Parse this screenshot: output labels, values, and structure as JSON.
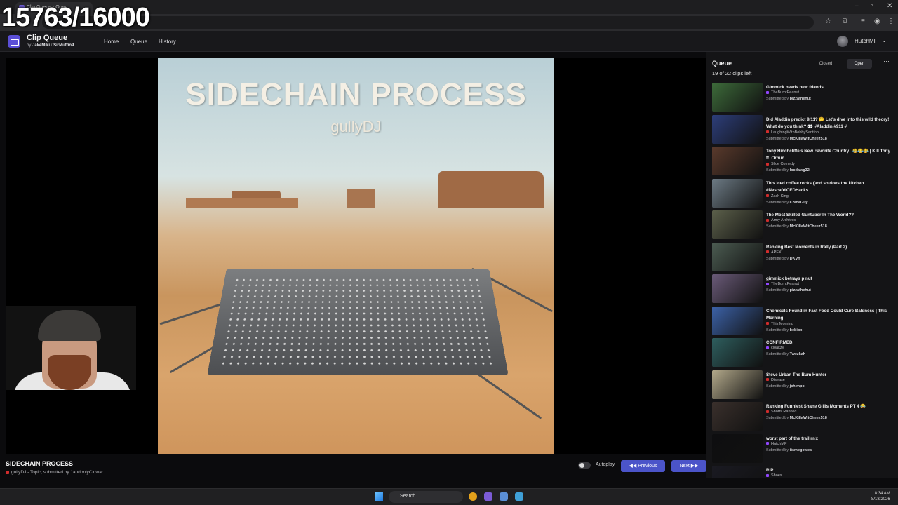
{
  "browser": {
    "tab_title": "Clip Queue - Open",
    "counter_overlay": "15763/16000"
  },
  "app": {
    "title": "Clip Queue",
    "by_text": "by",
    "author1": "JakeMiki",
    "separator": "/",
    "author2": "SirMuffin9",
    "nav": [
      "Home",
      "Queue",
      "History"
    ],
    "active_nav": "Queue",
    "user_name": "HutchMF"
  },
  "player": {
    "art_title": "SIDECHAIN PROCESS",
    "art_subtitle": "gullyDJ"
  },
  "current_clip": {
    "title": "SIDECHAIN PROCESS",
    "meta": "gullyDJ - Topic, submitted by 1andonlyCidwar"
  },
  "controls": {
    "autoplay_label": "Autoplay",
    "autoplay_on": false,
    "previous_label": "Previous",
    "next_label": "Next"
  },
  "queue": {
    "title": "Queue",
    "count_text": "19 of 22 clips left",
    "closed_label": "Closed",
    "open_label": "Open",
    "items": [
      {
        "title": "Gimmick needs new friends",
        "channel": "TheBurntPeanut",
        "submitted_prefix": "Submitted by",
        "submitter": "pizzathehut",
        "platform_color": "#9146ff",
        "thumb": "#3d6b3a"
      },
      {
        "title": "Did Aladdin predict 9/11? 🤔 Let's dive into this wild theory! What do you think? 👀 #Aladdin #911 #",
        "channel": "LaughingWithBobbySantino",
        "submitted_prefix": "Submitted by",
        "submitter": "McKillaWitCheez518",
        "platform_color": "#d12c2c",
        "thumb": "#2d3e7a"
      },
      {
        "title": "Tony Hinchcliffe's New Favorite Country.. 😂😂😂 | Kill Tony ft. Orhun",
        "channel": "Slice Comedy",
        "submitted_prefix": "Submitted by",
        "submitter": "locdawg32",
        "platform_color": "#d12c2c",
        "thumb": "#5a3a2c"
      },
      {
        "title": "This iced coffee rocks (and so does the kitchen #NescaféICEDHacks",
        "channel": "Zach King",
        "submitted_prefix": "Submitted by",
        "submitter": "ChibaGuy",
        "platform_color": "#d12c2c",
        "thumb": "#6c7a84"
      },
      {
        "title": "The Most Skilled Guntuber In The World??",
        "channel": "Army Archives",
        "submitted_prefix": "Submitted by",
        "submitter": "McKillaWitCheez518",
        "platform_color": "#d12c2c",
        "thumb": "#5b5f4a"
      },
      {
        "title": "Ranking Best Moments in Rally (Part 2)",
        "channel": "APEX",
        "submitted_prefix": "Submitted by",
        "submitter": "DKVY_",
        "platform_color": "#d12c2c",
        "thumb": "#4c5c52"
      },
      {
        "title": "gimmick betrays p nut",
        "channel": "TheBurntPeanut",
        "submitted_prefix": "Submitted by",
        "submitter": "pizzathehut",
        "platform_color": "#9146ff",
        "thumb": "#6a5a78"
      },
      {
        "title": "Chemicals Found in Fast Food Could Cure Baldness | This Morning",
        "channel": "This Morning",
        "submitted_prefix": "Submitted by",
        "submitter": "bebiox",
        "platform_color": "#d12c2c",
        "thumb": "#3c62a8"
      },
      {
        "title": "CONFIRMED.",
        "channel": "cloakzy",
        "submitted_prefix": "Submitted by",
        "submitter": "Twezkah",
        "platform_color": "#9146ff",
        "thumb": "#2e5e5e"
      },
      {
        "title": "Steve Urban The Bum Hunter",
        "channel": "Disease",
        "submitted_prefix": "Submitted by",
        "submitter": "jchimpo",
        "platform_color": "#d12c2c",
        "thumb": "#b2a88a"
      },
      {
        "title": "Ranking Funniest Shane Gillis Moments PT 4 😂",
        "channel": "Shorts Ranked",
        "submitted_prefix": "Submitted by",
        "submitter": "McKillaWitCheez518",
        "platform_color": "#d12c2c",
        "thumb": "#3a302c"
      },
      {
        "title": "worst part of the trail mix",
        "channel": "HutchMF",
        "submitted_prefix": "Submitted by",
        "submitter": "itsmegowes",
        "platform_color": "#9146ff",
        "thumb": "#0e0e10"
      },
      {
        "title": "RIP",
        "channel": "Shoes",
        "submitted_prefix": "Submitted by",
        "submitter": "",
        "platform_color": "#9146ff",
        "thumb": "#1a1a22"
      }
    ]
  },
  "taskbar": {
    "search_label": "Search",
    "time": "8:34 AM",
    "date": "8/18/2026"
  }
}
